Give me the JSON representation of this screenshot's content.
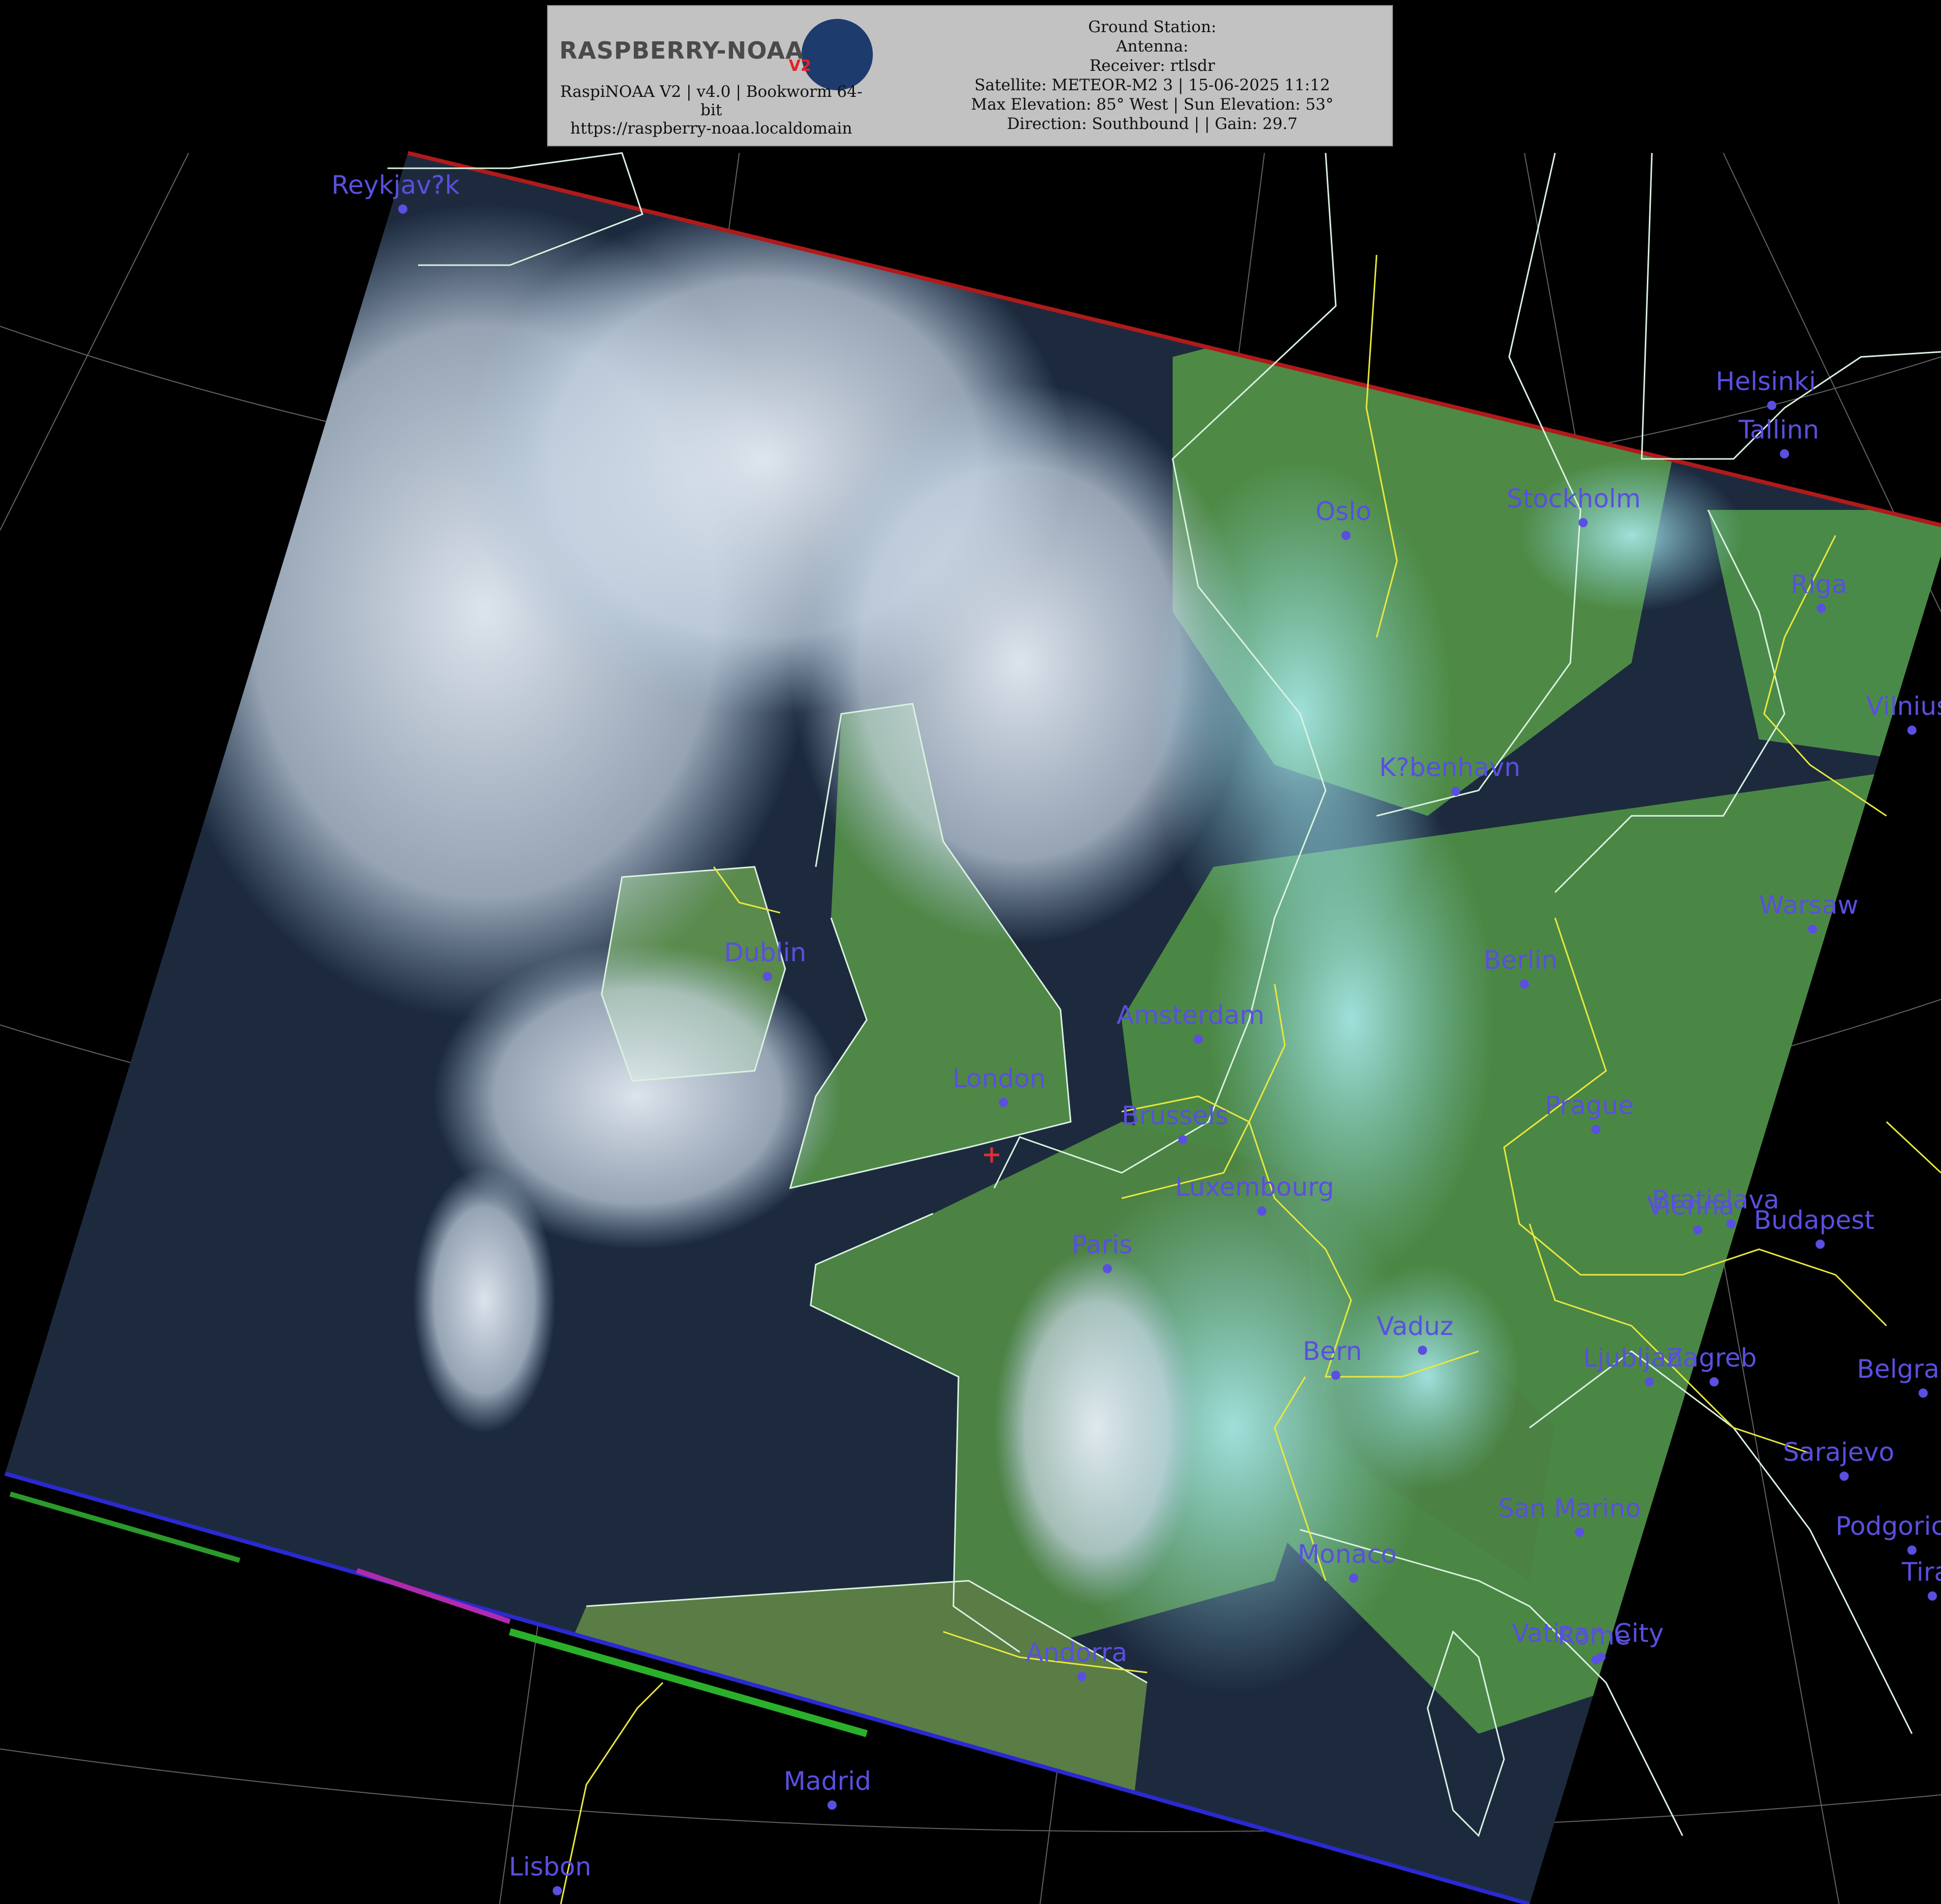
{
  "header": {
    "logo_text": "RASPBERRY-NOAA",
    "logo_badge": "V2",
    "software_line1": "RaspiNOAA V2 | v4.0 | Bookworm 64-",
    "software_line2": "bit",
    "url": "https://raspberry-noaa.localdomain",
    "ground_station": "Ground Station:",
    "antenna": "Antenna:",
    "receiver": "Receiver: rtlsdr",
    "satellite": "Satellite: METEOR-M2 3 | 15-06-2025 11:12",
    "elevation": "Max Elevation: 85° West | Sun Elevation: 53°",
    "direction": "Direction: Southbound | | Gain: 29.7"
  },
  "cities": [
    {
      "name": "Reykjav?k"
    },
    {
      "name": "Helsinki"
    },
    {
      "name": "Tallinn"
    },
    {
      "name": "Oslo"
    },
    {
      "name": "Stockholm"
    },
    {
      "name": "Riga"
    },
    {
      "name": "Vilnius"
    },
    {
      "name": "K?benhavn"
    },
    {
      "name": "Warsaw"
    },
    {
      "name": "Dublin"
    },
    {
      "name": "Berlin"
    },
    {
      "name": "Amsterdam"
    },
    {
      "name": "London"
    },
    {
      "name": "Brussels"
    },
    {
      "name": "Prague"
    },
    {
      "name": "Luxembourg"
    },
    {
      "name": "Paris"
    },
    {
      "name": "Bratislava"
    },
    {
      "name": "Vienna"
    },
    {
      "name": "Budapest"
    },
    {
      "name": "Vaduz"
    },
    {
      "name": "Bern"
    },
    {
      "name": "Ljubljana"
    },
    {
      "name": "Zagreb"
    },
    {
      "name": "Belgrade"
    },
    {
      "name": "Sarajevo"
    },
    {
      "name": "San Marino"
    },
    {
      "name": "Podgorica"
    },
    {
      "name": "Monaco"
    },
    {
      "name": "Tirana"
    },
    {
      "name": "Vatican City"
    },
    {
      "name": "Rome"
    },
    {
      "name": "Andorra"
    },
    {
      "name": "Madrid"
    },
    {
      "name": "Lisbon"
    }
  ],
  "colors": {
    "background": "#000000",
    "header_bg": "#c2c2c2",
    "city_label": "#5a4fe0",
    "coastline": "#d9f2e0",
    "borders": "#e8e840",
    "graticule": "#9a9a9a",
    "sea": "#1d2a3e",
    "land": "#4e8a45",
    "cloud": "#c9d7e6",
    "marker": "#e03030"
  },
  "icons": {
    "logo": "raspberry-noaa-satellite-logo",
    "station_marker": "red-cross-marker"
  }
}
